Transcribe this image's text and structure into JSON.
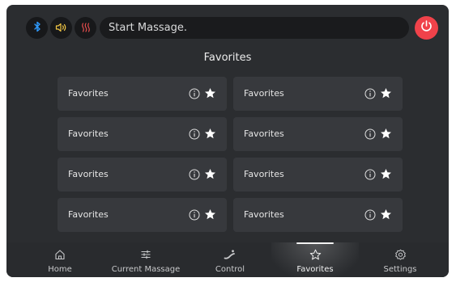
{
  "header": {
    "status_text": "Start Massage.",
    "indicators": [
      {
        "icon": "bluetooth-icon",
        "color": "#2f9bff"
      },
      {
        "icon": "volume-icon",
        "color": "#f2c744"
      },
      {
        "icon": "heat-icon",
        "color": "#e84d4d"
      }
    ],
    "power_button": {
      "icon": "power-icon",
      "color": "#f0424a"
    }
  },
  "page": {
    "title": "Favorites"
  },
  "favorites": [
    {
      "label": "Favorites"
    },
    {
      "label": "Favorites"
    },
    {
      "label": "Favorites"
    },
    {
      "label": "Favorites"
    },
    {
      "label": "Favorites"
    },
    {
      "label": "Favorites"
    },
    {
      "label": "Favorites"
    },
    {
      "label": "Favorites"
    }
  ],
  "nav": {
    "items": [
      {
        "label": "Home",
        "icon": "home-icon"
      },
      {
        "label": "Current Massage",
        "icon": "sliders-icon"
      },
      {
        "label": "Control",
        "icon": "control-icon"
      },
      {
        "label": "Favorites",
        "icon": "star-icon",
        "active": true
      },
      {
        "label": "Settings",
        "icon": "gear-icon"
      }
    ]
  }
}
